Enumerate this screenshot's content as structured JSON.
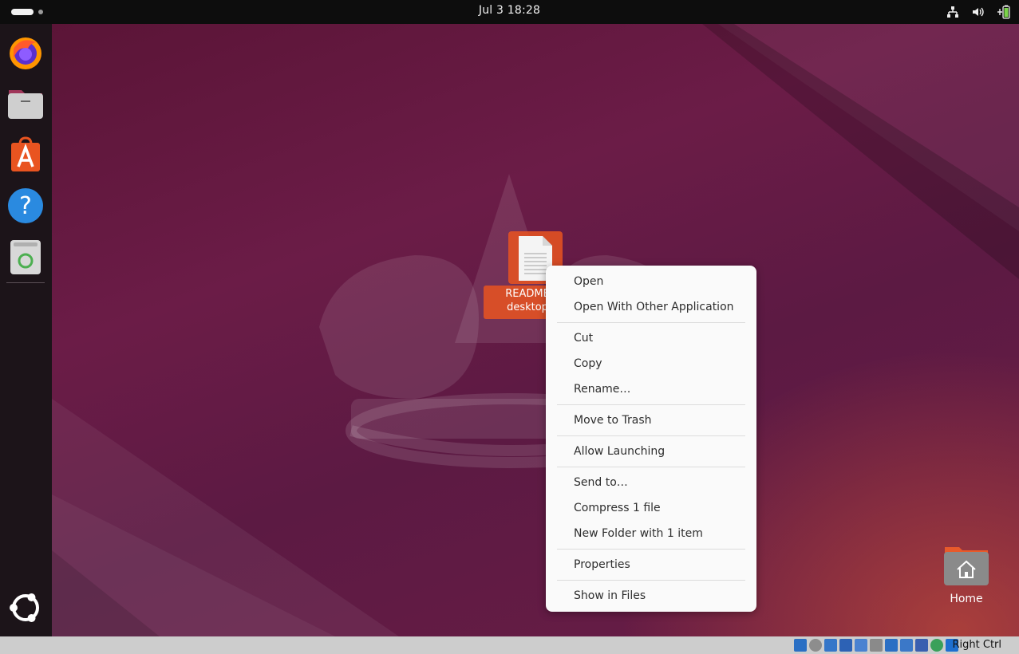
{
  "topbar": {
    "clock": "Jul 3  18:28",
    "tray_icons": [
      "network-icon",
      "volume-icon",
      "battery-icon"
    ]
  },
  "dock": {
    "apps": [
      {
        "name": "firefox-icon"
      },
      {
        "name": "files-icon"
      },
      {
        "name": "app-center-icon"
      },
      {
        "name": "help-icon"
      },
      {
        "name": "trash-icon"
      }
    ],
    "show_apps_icon": "ubuntu-logo-icon"
  },
  "desktop": {
    "file": {
      "label_line1": "README",
      "label_line2": "desktop"
    },
    "home": {
      "label": "Home"
    }
  },
  "context_menu": {
    "items": [
      "Open",
      "Open With Other Application",
      "Cut",
      "Copy",
      "Rename…",
      "Move to Trash",
      "Allow Launching",
      "Send to…",
      "Compress 1 file",
      "New Folder with 1 item",
      "Properties",
      "Show in Files"
    ]
  },
  "vbox_statusbar": {
    "host_key": "Right Ctrl"
  },
  "colors": {
    "accent": "#E95420",
    "topbar": "#0d0d0d",
    "dock": "#1c1419",
    "wallpaper": "#5a1a3e"
  }
}
